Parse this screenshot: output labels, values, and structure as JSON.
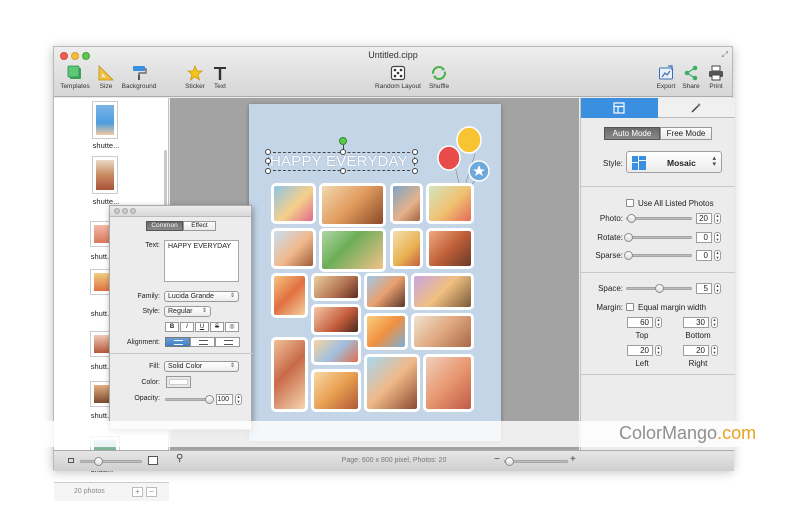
{
  "window": {
    "title": "Untitled.cipp"
  },
  "toolbar": {
    "templates": "Templates",
    "size": "Size",
    "background": "Background",
    "sticker": "Sticker",
    "text": "Text",
    "random_layout": "Random Layout",
    "shuffle": "Shuffle",
    "export": "Export",
    "share": "Share",
    "print": "Print"
  },
  "sidebar": {
    "items": [
      {
        "label": "shutte..."
      },
      {
        "label": "shutte..."
      },
      {
        "label": "shutt..."
      },
      {
        "label": "shutt..."
      },
      {
        "label": "shutt..."
      },
      {
        "label": "shutt..."
      },
      {
        "label": "shutt..."
      }
    ],
    "count": "20 photos",
    "add": "+",
    "remove": "−"
  },
  "canvas": {
    "title_text": "HAPPY EVERYDAY"
  },
  "text_inspector": {
    "tabs": [
      "Common",
      "Effect"
    ],
    "text_label": "Text:",
    "text_value": "HAPPY EVERYDAY",
    "family_label": "Family:",
    "family_value": "Lucida Grande",
    "style_label": "Style:",
    "style_value": "Regular",
    "format_buttons": [
      "B",
      "I",
      "U",
      "S",
      "◎"
    ],
    "alignment_label": "Alignment:",
    "fill_label": "Fill:",
    "fill_value": "Solid Color",
    "color_label": "Color:",
    "opacity_label": "Opacity:",
    "opacity_value": "100",
    "opacity_fraction": 1.0
  },
  "right_panel": {
    "mode": {
      "auto": "Auto Mode",
      "free": "Free Mode",
      "selected": "auto"
    },
    "style_label": "Style:",
    "style_value": "Mosaic",
    "use_all": "Use All Listed Photos",
    "photo_label": "Photo:",
    "photo_value": "20",
    "photo_fraction": 0.05,
    "rotate_label": "Rotate:",
    "rotate_value": "0",
    "rotate_fraction": 0.0,
    "sparse_label": "Sparse:",
    "sparse_value": "0",
    "sparse_fraction": 0.0,
    "space_label": "Space:",
    "space_value": "5",
    "space_fraction": 0.5,
    "margin_label": "Margin:",
    "equal_margin": "Equal margin width",
    "top_value": "60",
    "bottom_value": "30",
    "left_value": "20",
    "right_value": "20",
    "top_label": "Top",
    "bottom_label": "Bottom",
    "left_label": "Left",
    "right_label": "Right"
  },
  "status_bar": {
    "text": "Page: 600 x 800 pixel, Photos: 20"
  },
  "watermark": {
    "part1": "ColorMango",
    "part2": ".com"
  },
  "colors": {
    "accent": "#3b8fe0",
    "page_bg": "#c3d5e6",
    "canvas_bg": "#a3a3a3",
    "watermark_main": "#8f8f8f",
    "watermark_accent": "#e8a31f"
  }
}
